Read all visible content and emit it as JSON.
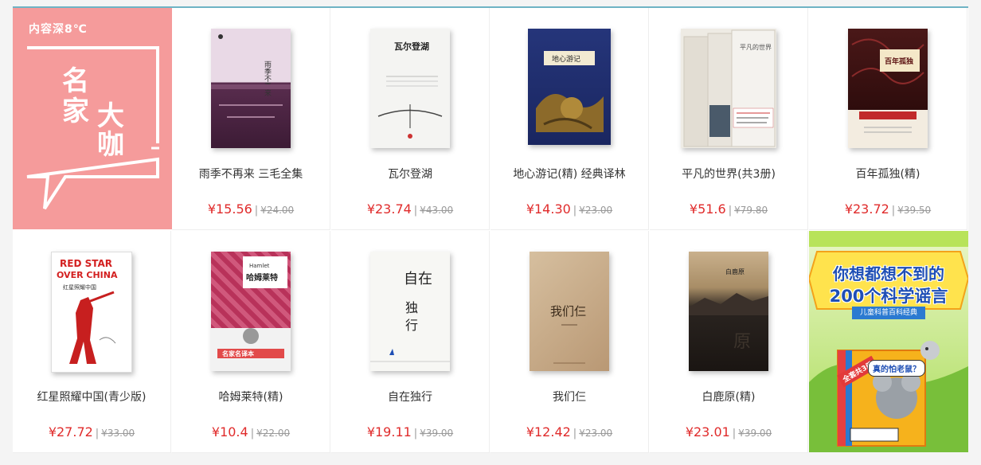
{
  "promo": {
    "label": "内容深8℃",
    "title_chars": [
      "名",
      "家",
      "大",
      "咖"
    ],
    "bg_color": "#f59b9b"
  },
  "books": [
    {
      "title": "雨季不再来 三毛全集",
      "price": "¥15.56",
      "original_price": "¥24.00",
      "cover_color": "#5a2d4f",
      "cover_text": "雨季不再来"
    },
    {
      "title": "瓦尔登湖",
      "price": "¥23.74",
      "original_price": "¥43.00",
      "cover_color": "#f2f2f2",
      "cover_text": "瓦尔登湖"
    },
    {
      "title": "地心游记(精) 经典译林",
      "price": "¥14.30",
      "original_price": "¥23.00",
      "cover_color": "#1f2f6e",
      "cover_text": "地心游记"
    },
    {
      "title": "平凡的世界(共3册)",
      "price": "¥51.6",
      "original_price": "¥79.80",
      "cover_color": "#e9e6e0",
      "cover_text": "平凡的世界"
    },
    {
      "title": "百年孤独(精)",
      "price": "¥23.72",
      "original_price": "¥39.50",
      "cover_color": "#3a1414",
      "cover_text": "百年孤独"
    },
    {
      "title": "红星照耀中国(青少版)",
      "price": "¥27.72",
      "original_price": "¥33.00",
      "cover_color": "#ffffff",
      "cover_text": "RED STAR OVER CHINA"
    },
    {
      "title": "哈姆莱特(精)",
      "price": "¥10.4",
      "original_price": "¥22.00",
      "cover_color": "#b8325a",
      "cover_text": "哈姆莱特"
    },
    {
      "title": "自在独行",
      "price": "¥19.11",
      "original_price": "¥39.00",
      "cover_color": "#f5f5f2",
      "cover_text": "自在独行"
    },
    {
      "title": "我们仨",
      "price": "¥12.42",
      "original_price": "¥23.00",
      "cover_color": "#c8ab8a",
      "cover_text": "我们仨"
    },
    {
      "title": "白鹿原(精)",
      "price": "¥23.01",
      "original_price": "¥39.00",
      "cover_color": "#2a2420",
      "cover_text": "白鹿原"
    }
  ],
  "ad": {
    "line1": "你想都想不到的",
    "line2": "200个科学谣言",
    "subtitle": "儿童科普百科经典",
    "badge": "全套共3册",
    "bubble": "真的怕老鼠？"
  },
  "colors": {
    "price": "#e02b2b",
    "old_price": "#999999",
    "title": "#333333",
    "accent_line": "#6fb3c4"
  }
}
